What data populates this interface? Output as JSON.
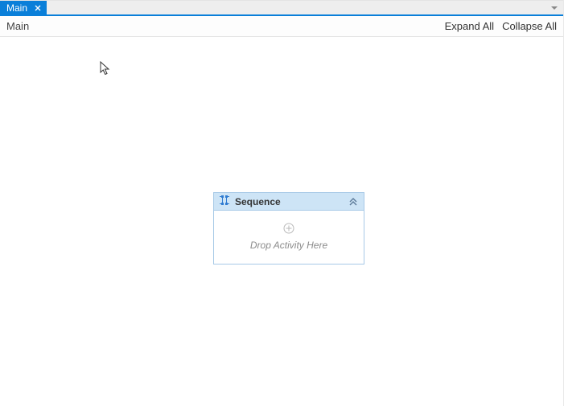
{
  "tabs": {
    "active": {
      "label": "Main"
    }
  },
  "breadcrumb": {
    "root": "Main"
  },
  "toolbar": {
    "expand_all": "Expand All",
    "collapse_all": "Collapse All"
  },
  "designer": {
    "activity": {
      "title": "Sequence",
      "drop_hint": "Drop Activity Here"
    }
  }
}
